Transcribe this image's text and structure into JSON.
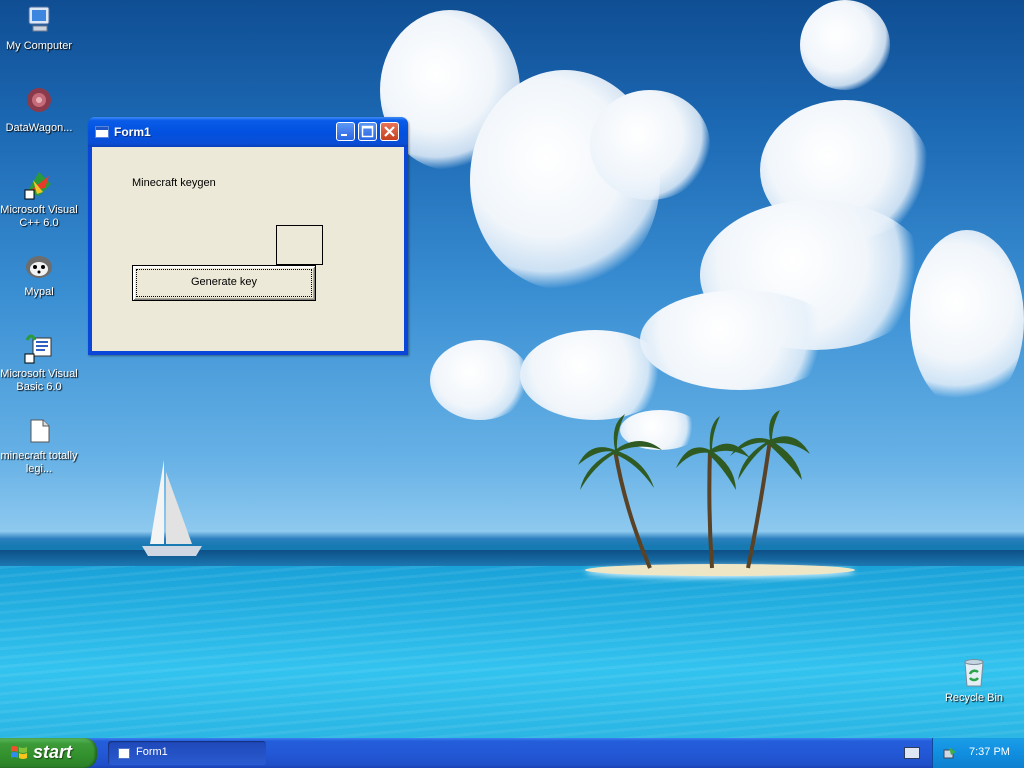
{
  "desktop": {
    "icons": [
      {
        "label": "My Computer",
        "icon": "my-computer-icon"
      },
      {
        "label": "DataWagon...",
        "icon": "datawagon-icon"
      },
      {
        "label": "Microsoft Visual C++ 6.0",
        "icon": "visual-cpp-icon"
      },
      {
        "label": "Mypal",
        "icon": "mypal-icon"
      },
      {
        "label": "Microsoft Visual Basic 6.0",
        "icon": "visual-basic-icon"
      },
      {
        "label": "minecraft totally legi...",
        "icon": "file-icon"
      },
      {
        "label": "Recycle Bin",
        "icon": "recycle-bin-icon"
      }
    ]
  },
  "window": {
    "title": "Form1",
    "label": "Minecraft keygen",
    "button": "Generate key",
    "controls": {
      "minimize": "minimize-icon",
      "maximize": "maximize-icon",
      "close": "close-icon"
    }
  },
  "taskbar": {
    "start_label": "start",
    "tasks": [
      {
        "label": "Form1"
      }
    ],
    "clock": "7:37 PM"
  },
  "colors": {
    "titlebar": "#0251e0",
    "taskbar": "#245edb",
    "start": "#3c9b38",
    "window_bg": "#ece9d8"
  }
}
